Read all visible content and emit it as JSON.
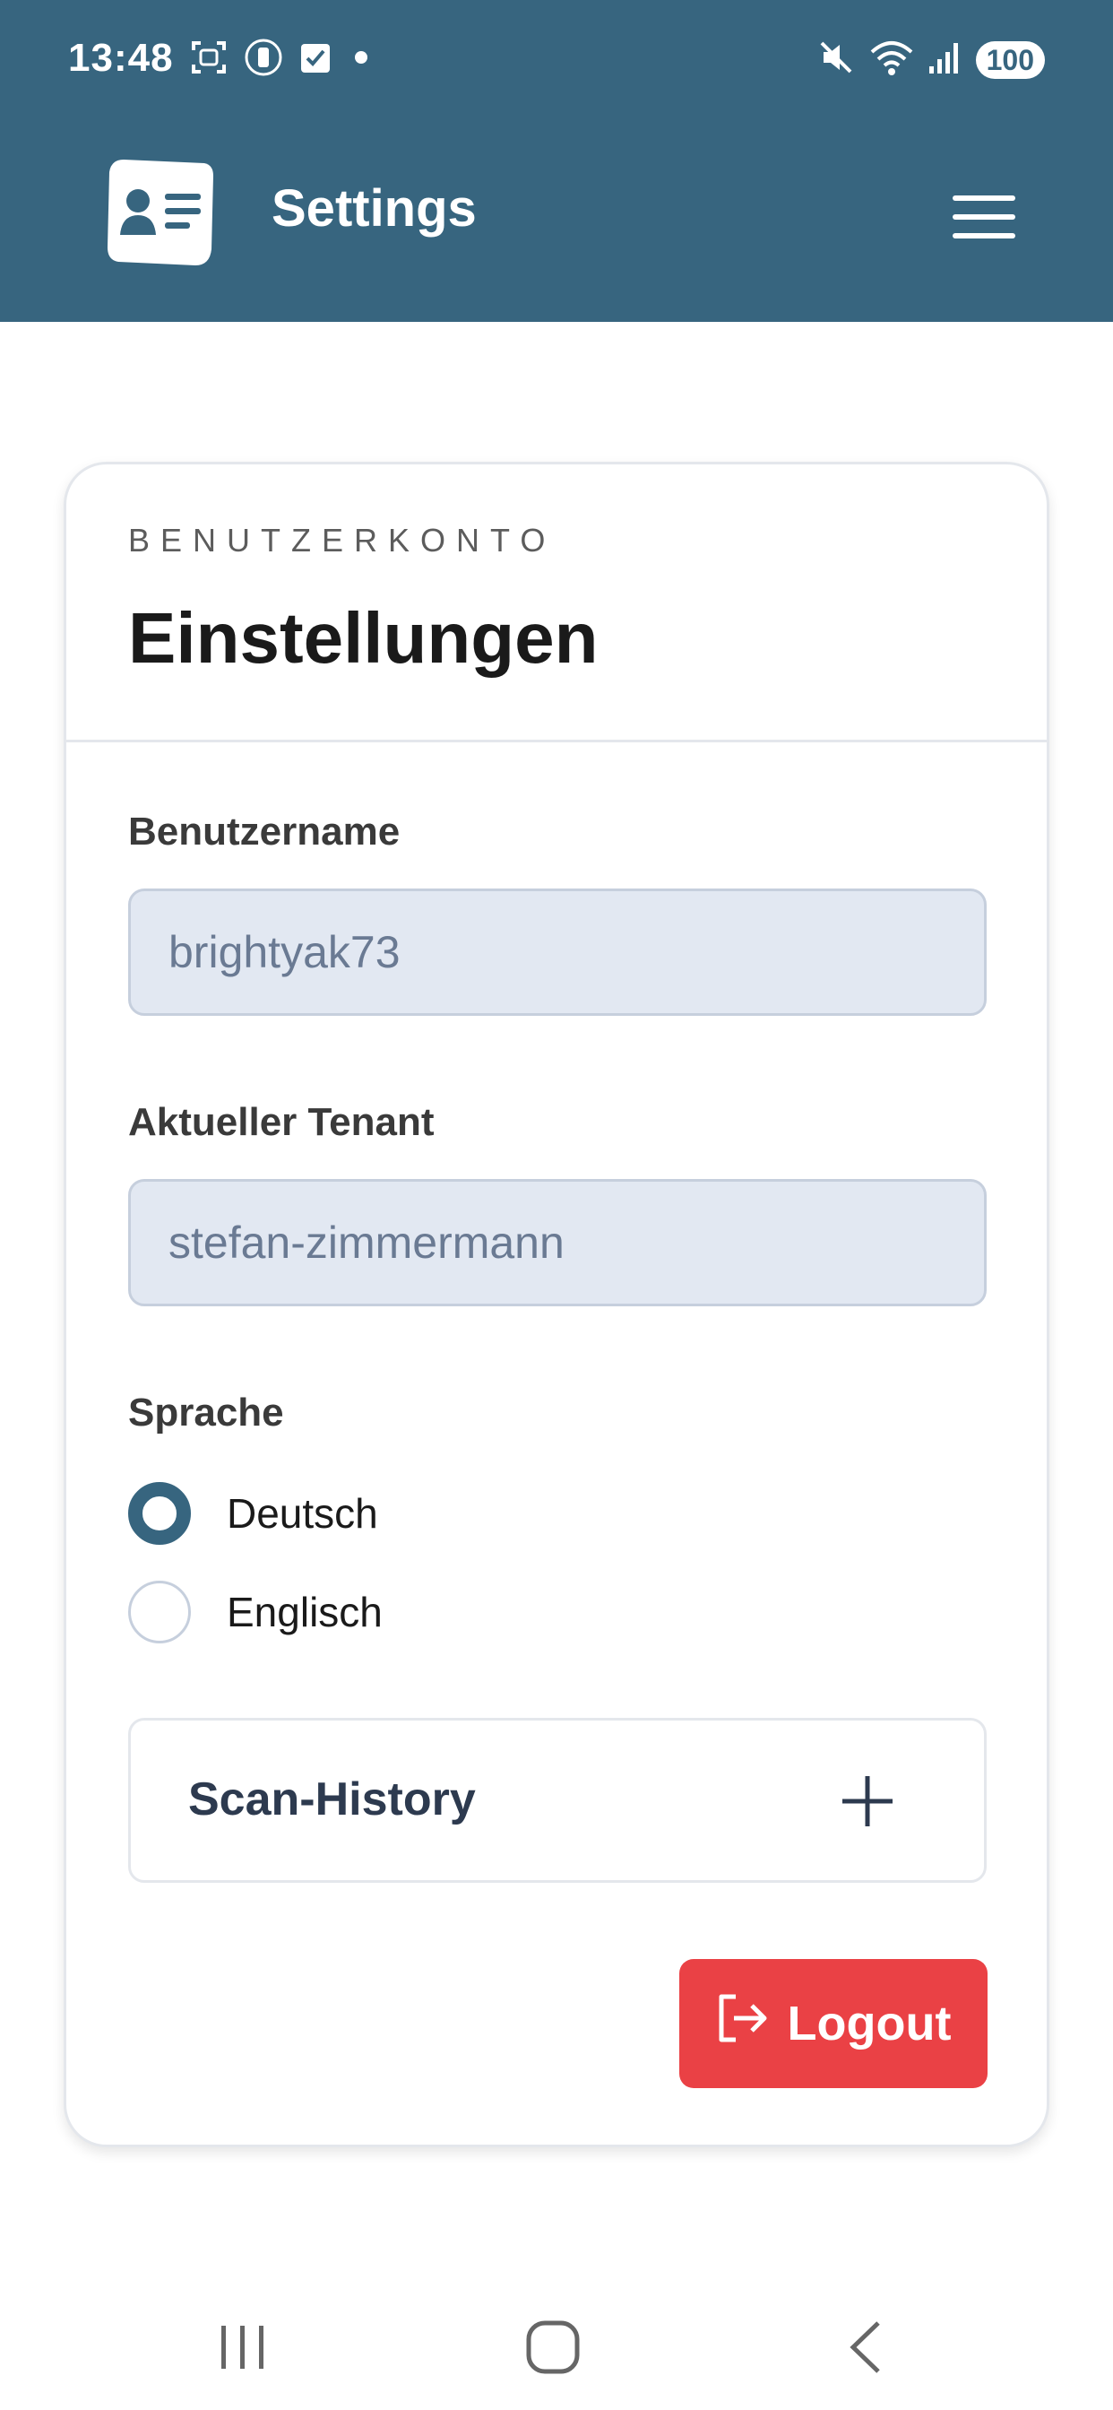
{
  "status_bar": {
    "time": "13:48",
    "battery": "100",
    "left_icons": [
      "screenshot-icon",
      "vibrate-icon",
      "task-check-icon",
      "dot-icon"
    ],
    "right_icons": [
      "mute-icon",
      "wifi-icon",
      "signal-icon"
    ]
  },
  "app_bar": {
    "title": "Settings",
    "logo_icon": "id-card-icon",
    "menu_icon": "hamburger-icon"
  },
  "card": {
    "eyebrow": "BENUTZERKONTO",
    "title": "Einstellungen",
    "fields": [
      {
        "label": "Benutzername",
        "value": "brightyak73"
      },
      {
        "label": "Aktueller Tenant",
        "value": "stefan-zimmermann"
      }
    ],
    "language": {
      "label": "Sprache",
      "options": [
        {
          "label": "Deutsch",
          "checked": true
        },
        {
          "label": "Englisch",
          "checked": false
        }
      ]
    },
    "history": {
      "title": "Scan-History",
      "expand_icon": "plus-icon"
    },
    "logout_label": "Logout"
  },
  "colors": {
    "primary": "#37657f",
    "danger": "#ea4145",
    "input_bg": "#e2e8f2",
    "input_text": "#6a7a93"
  },
  "nav_bar": {
    "items": [
      "recent-apps-icon",
      "home-icon",
      "back-icon"
    ]
  }
}
